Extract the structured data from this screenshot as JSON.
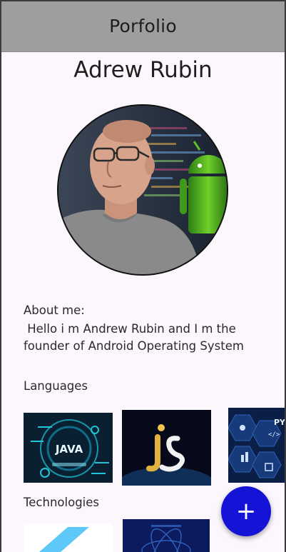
{
  "appbar": {
    "title": "Porfolio"
  },
  "profile": {
    "name": "Adrew Rubin",
    "avatar_label": "Andrew Rubin with Android robot"
  },
  "about": {
    "title": "About me:",
    "text": " Hello i m Andrew Rubin and I m the founder of Android Operating System"
  },
  "languages": {
    "label": "Languages",
    "items": [
      {
        "name": "JAVA",
        "icon": "java-logo"
      },
      {
        "name": "JS",
        "icon": "javascript-logo"
      },
      {
        "name": "PY",
        "icon": "python-tech-logo"
      }
    ]
  },
  "technologies": {
    "label": "Technologies",
    "items": [
      {
        "name": "Flutter",
        "icon": "flutter-logo"
      },
      {
        "name": "React",
        "icon": "react-logo"
      }
    ]
  },
  "fab": {
    "label": "+"
  },
  "colors": {
    "appbar": "#9e9e9e",
    "background": "#fcf7fc",
    "fab": "#1413d6"
  }
}
